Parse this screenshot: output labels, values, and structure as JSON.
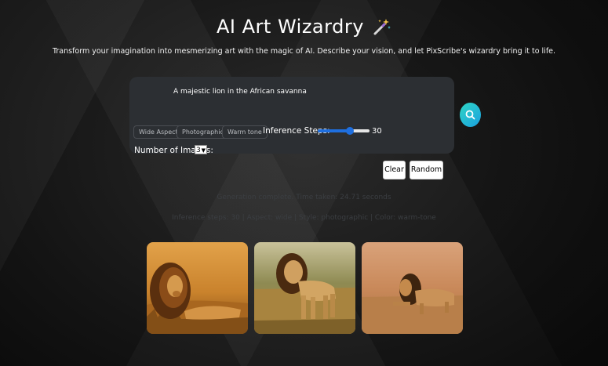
{
  "header": {
    "title": "AI Art Wizardry",
    "subtitle": "Transform your imagination into mesmerizing art with the magic of AI. Describe your vision, and let PixScribe's wizardry bring it to life."
  },
  "prompt": {
    "value": "A majestic lion in the African savanna"
  },
  "style_chips": [
    "Wide Aspect",
    "Photographic",
    "Warm tone"
  ],
  "inference": {
    "label": "Inference Steps:",
    "value": "30",
    "fraction": 0.62
  },
  "num_images": {
    "label": "Number of Images:",
    "value": "3"
  },
  "buttons": {
    "clear": "Clear",
    "random": "Random"
  },
  "status": {
    "line1": "Generation complete. Time taken: 24.71 seconds",
    "line2": "Inference steps: 30 | Aspect: wide | Style: photographic | Color: warm-tone"
  },
  "colors": {
    "accent": "#1e6fe0",
    "search": "#1fb8d8",
    "panel": "#2c2f33"
  },
  "images": [
    "lion-lying-grass",
    "lion-standing-savanna",
    "lion-walking-dry-grass"
  ]
}
